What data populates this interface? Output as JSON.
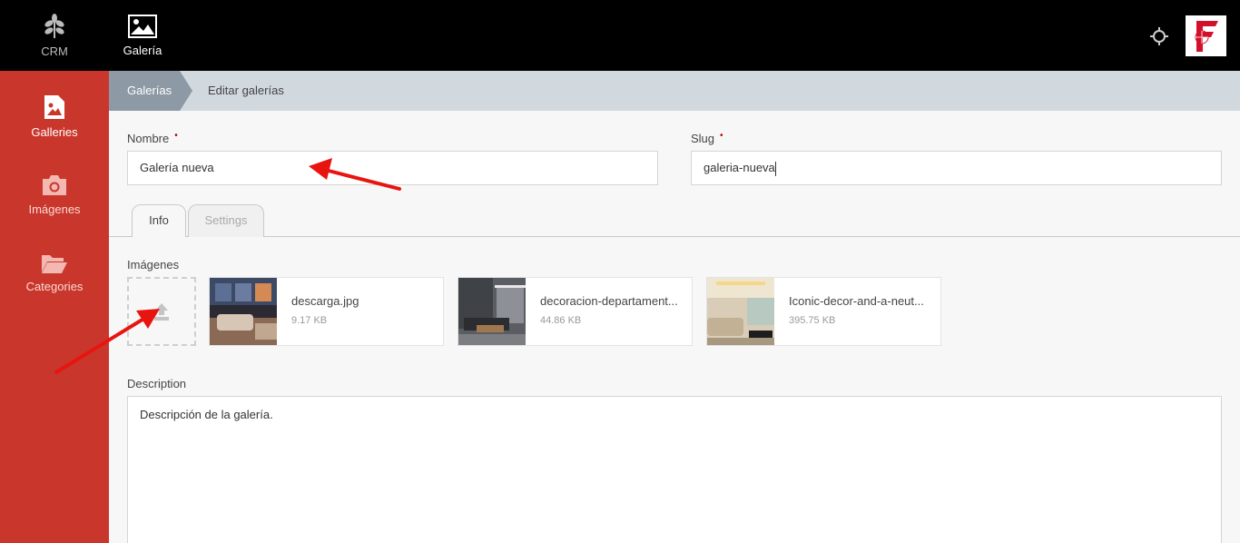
{
  "topbar": {
    "apps": [
      {
        "label": "CRM",
        "icon": "leaf-icon"
      },
      {
        "label": "Galería",
        "icon": "image-icon"
      }
    ],
    "target_icon": "crosshair-icon",
    "logo_icon": "company-logo-icon"
  },
  "sidebar": {
    "items": [
      {
        "label": "Galleries",
        "icon": "image-file-icon"
      },
      {
        "label": "Imágenes",
        "icon": "camera-icon"
      },
      {
        "label": "Categories",
        "icon": "folder-open-icon"
      }
    ]
  },
  "breadcrumb": {
    "first": "Galerías",
    "second": "Editar galerías"
  },
  "form": {
    "nombre_label": "Nombre",
    "nombre_value": "Galería nueva",
    "slug_label": "Slug",
    "slug_value": "galeria-nueva",
    "required_mark": "•"
  },
  "tabs": [
    {
      "label": "Info"
    },
    {
      "label": "Settings"
    }
  ],
  "images": {
    "label": "Imágenes",
    "upload_icon": "upload-icon",
    "files": [
      {
        "name": "descarga.jpg",
        "size": "9.17 KB"
      },
      {
        "name": "decoracion-departament...",
        "size": "44.86 KB"
      },
      {
        "name": "Iconic-decor-and-a-neut...",
        "size": "395.75 KB"
      }
    ]
  },
  "description": {
    "label": "Description",
    "value": "Descripción de la galería."
  },
  "colors": {
    "topbar": "#000000",
    "sidebar": "#c9372c",
    "breadcrumb_bg": "#d1d8de",
    "breadcrumb_active": "#8d99a4",
    "annotation_arrow": "#e8140f"
  }
}
